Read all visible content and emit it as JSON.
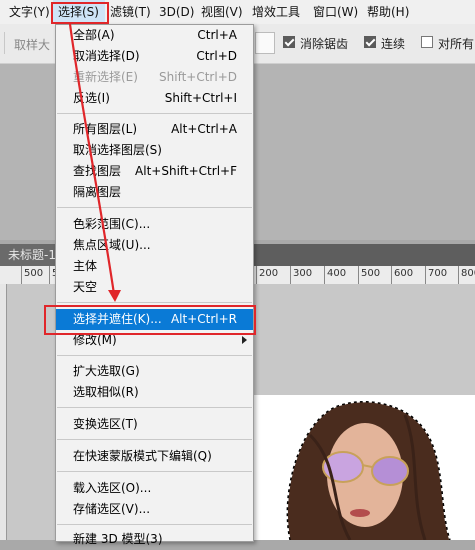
{
  "menubar": {
    "items": [
      {
        "label": "文字(Y)"
      },
      {
        "label": "选择(S)"
      },
      {
        "label": "滤镜(T)"
      },
      {
        "label": "3D(D)"
      },
      {
        "label": "视图(V)"
      },
      {
        "label": "增效工具"
      },
      {
        "label": "窗口(W)"
      },
      {
        "label": "帮助(H)"
      }
    ]
  },
  "options": {
    "sample_label": "取样大",
    "antialias": {
      "label": "消除锯齿",
      "checked": true
    },
    "contiguous": {
      "label": "连续",
      "checked": true
    },
    "all_layers": {
      "label": "对所有",
      "checked": false
    }
  },
  "document": {
    "tab_label": "未标题-1"
  },
  "ruler": {
    "left_ticks": [
      "500",
      "5"
    ],
    "right_ticks": [
      "200",
      "300",
      "400",
      "500",
      "600",
      "700",
      "800"
    ]
  },
  "select_menu": {
    "items": [
      {
        "label": "全部(A)",
        "shortcut": "Ctrl+A",
        "disabled": false
      },
      {
        "label": "取消选择(D)",
        "shortcut": "Ctrl+D",
        "disabled": false
      },
      {
        "label": "重新选择(E)",
        "shortcut": "Shift+Ctrl+D",
        "disabled": true
      },
      {
        "label": "反选(I)",
        "shortcut": "Shift+Ctrl+I",
        "disabled": false
      },
      {
        "label": "所有图层(L)",
        "shortcut": "Alt+Ctrl+A",
        "disabled": false
      },
      {
        "label": "取消选择图层(S)",
        "shortcut": "",
        "disabled": false
      },
      {
        "label": "查找图层",
        "shortcut": "Alt+Shift+Ctrl+F",
        "disabled": false
      },
      {
        "label": "隔离图层",
        "shortcut": "",
        "disabled": false
      },
      {
        "label": "色彩范围(C)...",
        "shortcut": "",
        "disabled": false
      },
      {
        "label": "焦点区域(U)...",
        "shortcut": "",
        "disabled": false
      },
      {
        "label": "主体",
        "shortcut": "",
        "disabled": false
      },
      {
        "label": "天空",
        "shortcut": "",
        "disabled": false
      },
      {
        "label": "选择并遮住(K)...",
        "shortcut": "Alt+Ctrl+R",
        "disabled": false,
        "highlighted": true
      },
      {
        "label": "修改(M)",
        "shortcut": "",
        "disabled": false,
        "submenu": true
      },
      {
        "label": "扩大选取(G)",
        "shortcut": "",
        "disabled": false
      },
      {
        "label": "选取相似(R)",
        "shortcut": "",
        "disabled": false
      },
      {
        "label": "变换选区(T)",
        "shortcut": "",
        "disabled": false
      },
      {
        "label": "在快速蒙版模式下编辑(Q)",
        "shortcut": "",
        "disabled": false
      },
      {
        "label": "载入选区(O)...",
        "shortcut": "",
        "disabled": false
      },
      {
        "label": "存储选区(V)...",
        "shortcut": "",
        "disabled": false
      },
      {
        "label": "新建 3D 模型(3)",
        "shortcut": "",
        "disabled": false
      }
    ]
  },
  "colors": {
    "highlight": "#0a7ad6",
    "annotation_red": "#e0262a"
  }
}
